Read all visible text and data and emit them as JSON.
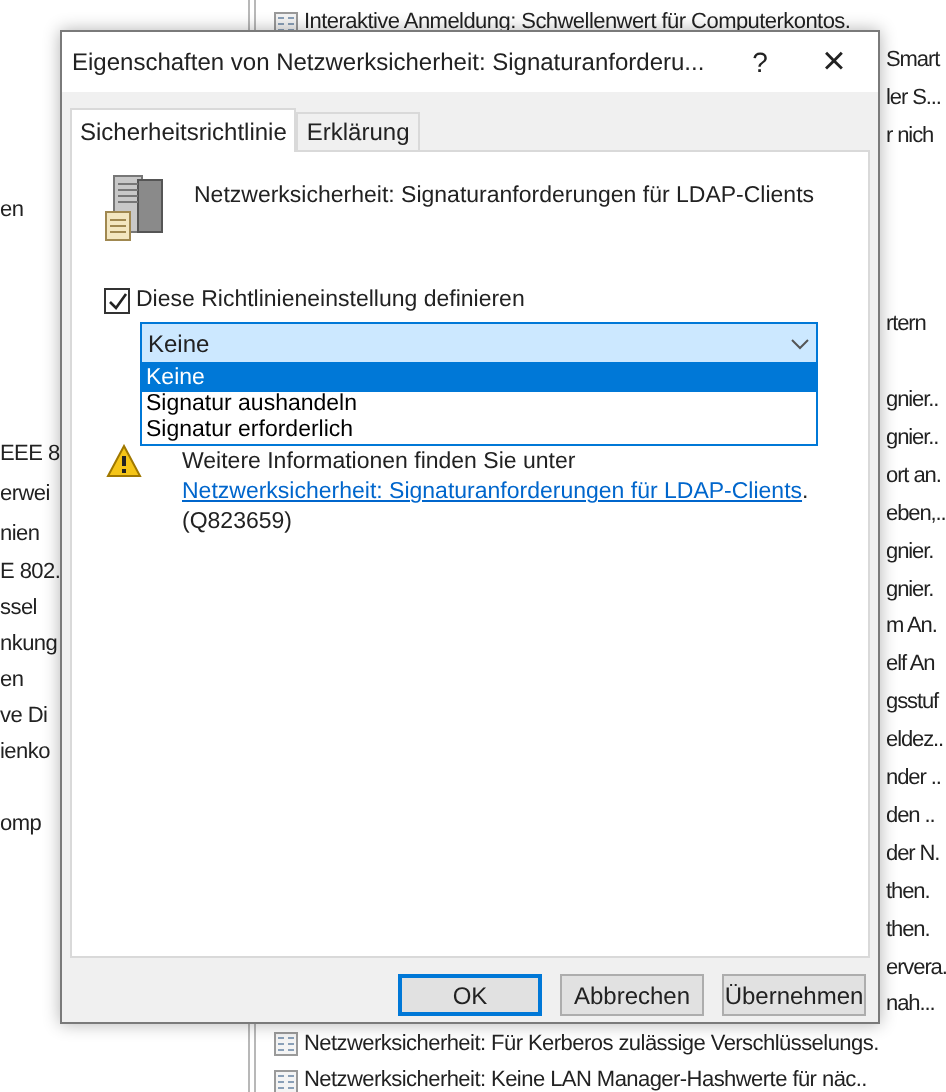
{
  "background_window": {
    "left_pane": {
      "items": [
        {
          "text": "en"
        },
        {
          "text": "EEE 8"
        },
        {
          "text": "erwei"
        },
        {
          "text": "nien"
        },
        {
          "text": "E 802."
        },
        {
          "text": "ssel"
        },
        {
          "text": "nkung"
        },
        {
          "text": "en"
        },
        {
          "text": "ve Di"
        },
        {
          "text": "ienko"
        },
        {
          "text": "omp"
        }
      ]
    },
    "right_pane": {
      "items": [
        {
          "kind": "full",
          "text": "Interaktive Anmeldung: Schwellenwert für Computerkontos."
        },
        {
          "kind": "fragment",
          "text": "Smart"
        },
        {
          "kind": "fragment",
          "text": "ler S..."
        },
        {
          "kind": "fragment",
          "text": "r nich"
        },
        {
          "kind": "fragment",
          "text": "rtern"
        },
        {
          "kind": "fragment",
          "text": "gnier.."
        },
        {
          "kind": "fragment",
          "text": "gnier.."
        },
        {
          "kind": "fragment",
          "text": "ort an."
        },
        {
          "kind": "fragment",
          "text": "eben,.."
        },
        {
          "kind": "fragment",
          "text": "gnier."
        },
        {
          "kind": "fragment",
          "text": "gnier."
        },
        {
          "kind": "fragment",
          "text": "m An."
        },
        {
          "kind": "fragment",
          "text": "elf An"
        },
        {
          "kind": "fragment",
          "text": "gsstuf"
        },
        {
          "kind": "fragment",
          "text": "eldez.."
        },
        {
          "kind": "fragment",
          "text": "nder .."
        },
        {
          "kind": "fragment",
          "text": "den .."
        },
        {
          "kind": "fragment",
          "text": "der N."
        },
        {
          "kind": "fragment",
          "text": "then."
        },
        {
          "kind": "fragment",
          "text": "then."
        },
        {
          "kind": "fragment",
          "text": "ervera."
        },
        {
          "kind": "fragment",
          "text": "nah..."
        },
        {
          "kind": "full",
          "text": "Netzwerksicherheit: Für Kerberos zulässige Verschlüsselungs."
        },
        {
          "kind": "full",
          "text": "Netzwerksicherheit: Keine LAN Manager-Hashwerte für näc.."
        }
      ]
    }
  },
  "dialog": {
    "title": "Eigenschaften von Netzwerksicherheit: Signaturanforderu...",
    "help": "?",
    "close": "×",
    "tabs": [
      {
        "label": "Sicherheitsrichtlinie",
        "selected": true
      },
      {
        "label": "Erklärung",
        "selected": false
      }
    ],
    "policy_name": "Netzwerksicherheit: Signaturanforderungen für LDAP-Clients",
    "define_setting": {
      "label": "Diese Richtlinieneinstellung definieren",
      "checked": true
    },
    "dropdown": {
      "value": "Keine",
      "expanded": true,
      "options": [
        {
          "label": "Keine",
          "selected": true
        },
        {
          "label": "Signatur aushandeln",
          "selected": false
        },
        {
          "label": "Signatur erforderlich",
          "selected": false
        }
      ]
    },
    "info": {
      "text": "Weitere Informationen finden Sie unter ",
      "link": "Netzwerksicherheit: Signaturanforderungen für LDAP-Clients",
      "suffix": ". (Q823659)"
    },
    "buttons": [
      {
        "label": "OK",
        "default": true
      },
      {
        "label": "Abbrechen",
        "default": false
      },
      {
        "label": "Übernehmen",
        "default": false
      }
    ]
  }
}
